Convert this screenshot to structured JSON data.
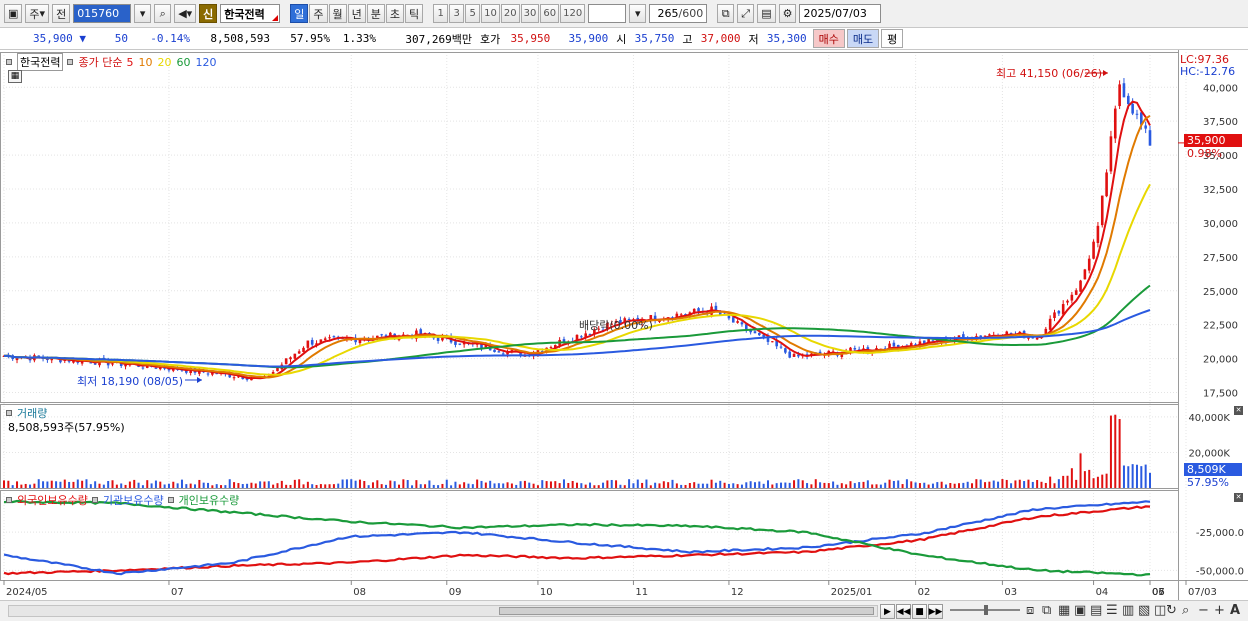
{
  "toolbar": {
    "market": "주",
    "prev_label": "전",
    "code": "015760",
    "shin": "신",
    "name": "한국전력",
    "periods": [
      "일",
      "주",
      "월",
      "년",
      "분",
      "초",
      "틱"
    ],
    "active_period": "일",
    "intervals": [
      "1",
      "3",
      "5",
      "10",
      "20",
      "30",
      "60",
      "120"
    ],
    "count": "265",
    "count_max": "/600",
    "date": "2025/07/03"
  },
  "quote": {
    "price": "35,900",
    "change": "50",
    "change_pct": "-0.14%",
    "volume": "8,508,593",
    "volume_ratio": "57.95%",
    "turnover_pct": "1.33%",
    "amount": "307,269백만",
    "ask_label": "호가",
    "ask": "35,950",
    "bid": "35,900",
    "open_label": "시",
    "open": "35,750",
    "high_label": "고",
    "high": "37,000",
    "low_label": "저",
    "low": "35,300",
    "buy": "매수",
    "sell": "매도",
    "avg": "평"
  },
  "price_panel": {
    "name": "한국전력",
    "ma_title": "종가 단순",
    "ma_periods": [
      {
        "label": "5",
        "color": "#e01010"
      },
      {
        "label": "10",
        "color": "#e07a00"
      },
      {
        "label": "20",
        "color": "#e8d800"
      },
      {
        "label": "60",
        "color": "#1a9a3a"
      },
      {
        "label": "120",
        "color": "#2a5ae0"
      }
    ],
    "lc": "LC:97.36",
    "hc": "HC:-12.76",
    "high_note": "최고 41,150 (06/26)",
    "low_note": "최저 18,190 (08/05)",
    "dividend_note": "배당락(0.00%)",
    "current_price": "35,900",
    "current_pct": "0.98%"
  },
  "volume_panel": {
    "title": "거래량",
    "value": "8,508,593주(57.95%)",
    "current": "8,509K",
    "current_pct": "57.95%"
  },
  "holding_panel": {
    "series": [
      {
        "label": "외국인보유수량",
        "color": "#e01010"
      },
      {
        "label": "기관보유수량",
        "color": "#2a5ae0"
      },
      {
        "label": "개인보유수량",
        "color": "#1a9a3a"
      }
    ]
  },
  "chart_data": [
    {
      "type": "candlestick",
      "title": "한국전력",
      "y_ticks": [
        17500,
        20000,
        22500,
        25000,
        27500,
        30000,
        32500,
        35000,
        37500,
        40000
      ],
      "ylim": [
        16800,
        42600
      ],
      "x_month_labels": [
        "2024/05",
        "07",
        "08",
        "09",
        "10",
        "11",
        "12",
        "2025/01",
        "02",
        "03",
        "04",
        "05",
        "06",
        "07",
        "07/03"
      ],
      "close_anchors": [
        {
          "date": "2024/05",
          "value": 20200
        },
        {
          "date": "2024/06",
          "value": 19800
        },
        {
          "date": "2024/07",
          "value": 19300
        },
        {
          "date": "2024/08/05",
          "value": 18500
        },
        {
          "date": "2024/08",
          "value": 21200
        },
        {
          "date": "2024/09",
          "value": 21800
        },
        {
          "date": "2024/10",
          "value": 20300
        },
        {
          "date": "2024/11",
          "value": 22600
        },
        {
          "date": "2024/12",
          "value": 23600
        },
        {
          "date": "2025/01",
          "value": 20100
        },
        {
          "date": "2025/02",
          "value": 20900
        },
        {
          "date": "2025/03",
          "value": 21900
        },
        {
          "date": "2025/04",
          "value": 21600
        },
        {
          "date": "2025/05",
          "value": 25600
        },
        {
          "date": "2025/06",
          "value": 29500
        },
        {
          "date": "2025/06/26",
          "value": 40300
        },
        {
          "date": "2025/07/03",
          "value": 35900
        }
      ]
    },
    {
      "type": "bar",
      "title": "거래량",
      "y_ticks": [
        20000,
        40000
      ],
      "ylim": [
        0,
        45000
      ],
      "unit": "K"
    },
    {
      "type": "line",
      "title": "보유수량",
      "y_ticks": [
        -25000,
        -50000
      ],
      "ylim": [
        -55000,
        0
      ],
      "series": [
        {
          "name": "외국인보유수량",
          "values_k": [
            -52000,
            -50000,
            -47000,
            -45000,
            -40000,
            -42000,
            -40000,
            -38000,
            -30000,
            -15000,
            -8000
          ]
        },
        {
          "name": "기관보유수량",
          "values_k": [
            -40000,
            -52000,
            -45000,
            -28000,
            -25000,
            -32000,
            -38000,
            -35000,
            -26000,
            -10000,
            -5000
          ]
        },
        {
          "name": "개인보유수량",
          "values_k": [
            -5000,
            -6000,
            -12000,
            -18000,
            -22000,
            -20000,
            -21000,
            -25000,
            -40000,
            -50000,
            -53000
          ]
        }
      ]
    }
  ]
}
